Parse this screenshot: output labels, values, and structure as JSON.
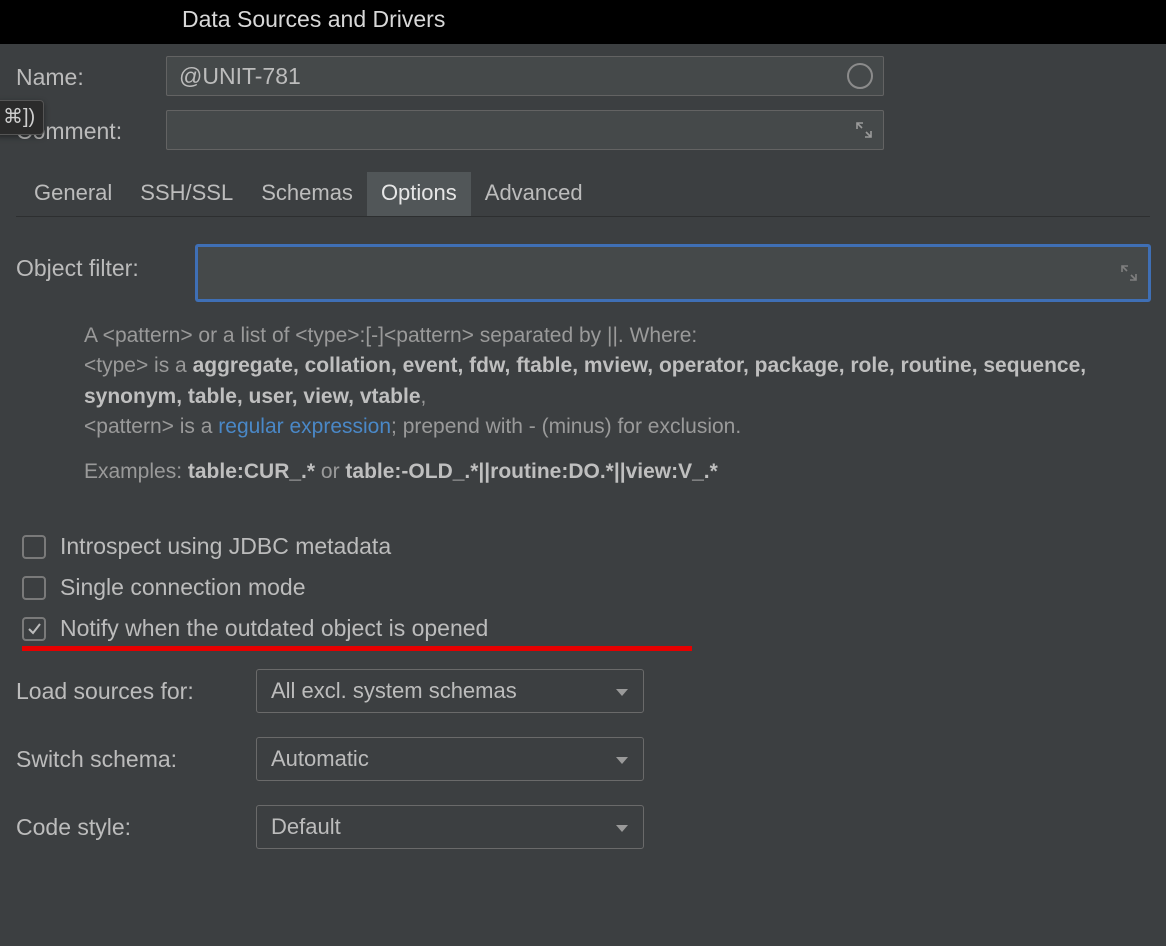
{
  "title": "Data Sources and Drivers",
  "shortcut_hint": "⌘])",
  "name_field": {
    "label": "Name:",
    "value": "@UNIT-781"
  },
  "comment_field": {
    "label": "Comment:",
    "value": ""
  },
  "tabs": {
    "general": "General",
    "sshssl": "SSH/SSL",
    "schemas": "Schemas",
    "options": "Options",
    "advanced": "Advanced"
  },
  "object_filter": {
    "label": "Object filter:",
    "value": ""
  },
  "help": {
    "line1_a": "A <pattern> or a list of <type>:[-]<pattern> separated by ||. Where:",
    "line2_a": "<type> is a ",
    "types": "aggregate, collation, event, fdw, ftable, mview, operator, package, role, routine, sequence, synonym, table, user, view, vtable",
    "line3_a": "<pattern> is a ",
    "link": "regular expression",
    "line3_b": "; prepend with - (minus) for exclusion.",
    "examples_label": "Examples: ",
    "ex1": "table:CUR_.*",
    "or": " or ",
    "ex2": "table:-OLD_.*||routine:DO.*||view:V_.*"
  },
  "checks": {
    "introspect": {
      "label": "Introspect using JDBC metadata",
      "checked": false
    },
    "single_conn": {
      "label": "Single connection mode",
      "checked": false
    },
    "notify": {
      "label": "Notify when the outdated object is opened",
      "checked": true
    }
  },
  "selects": {
    "load_sources": {
      "label": "Load sources for:",
      "value": "All excl. system schemas"
    },
    "switch_schema": {
      "label": "Switch schema:",
      "value": "Automatic"
    },
    "code_style": {
      "label": "Code style:",
      "value": "Default"
    }
  }
}
